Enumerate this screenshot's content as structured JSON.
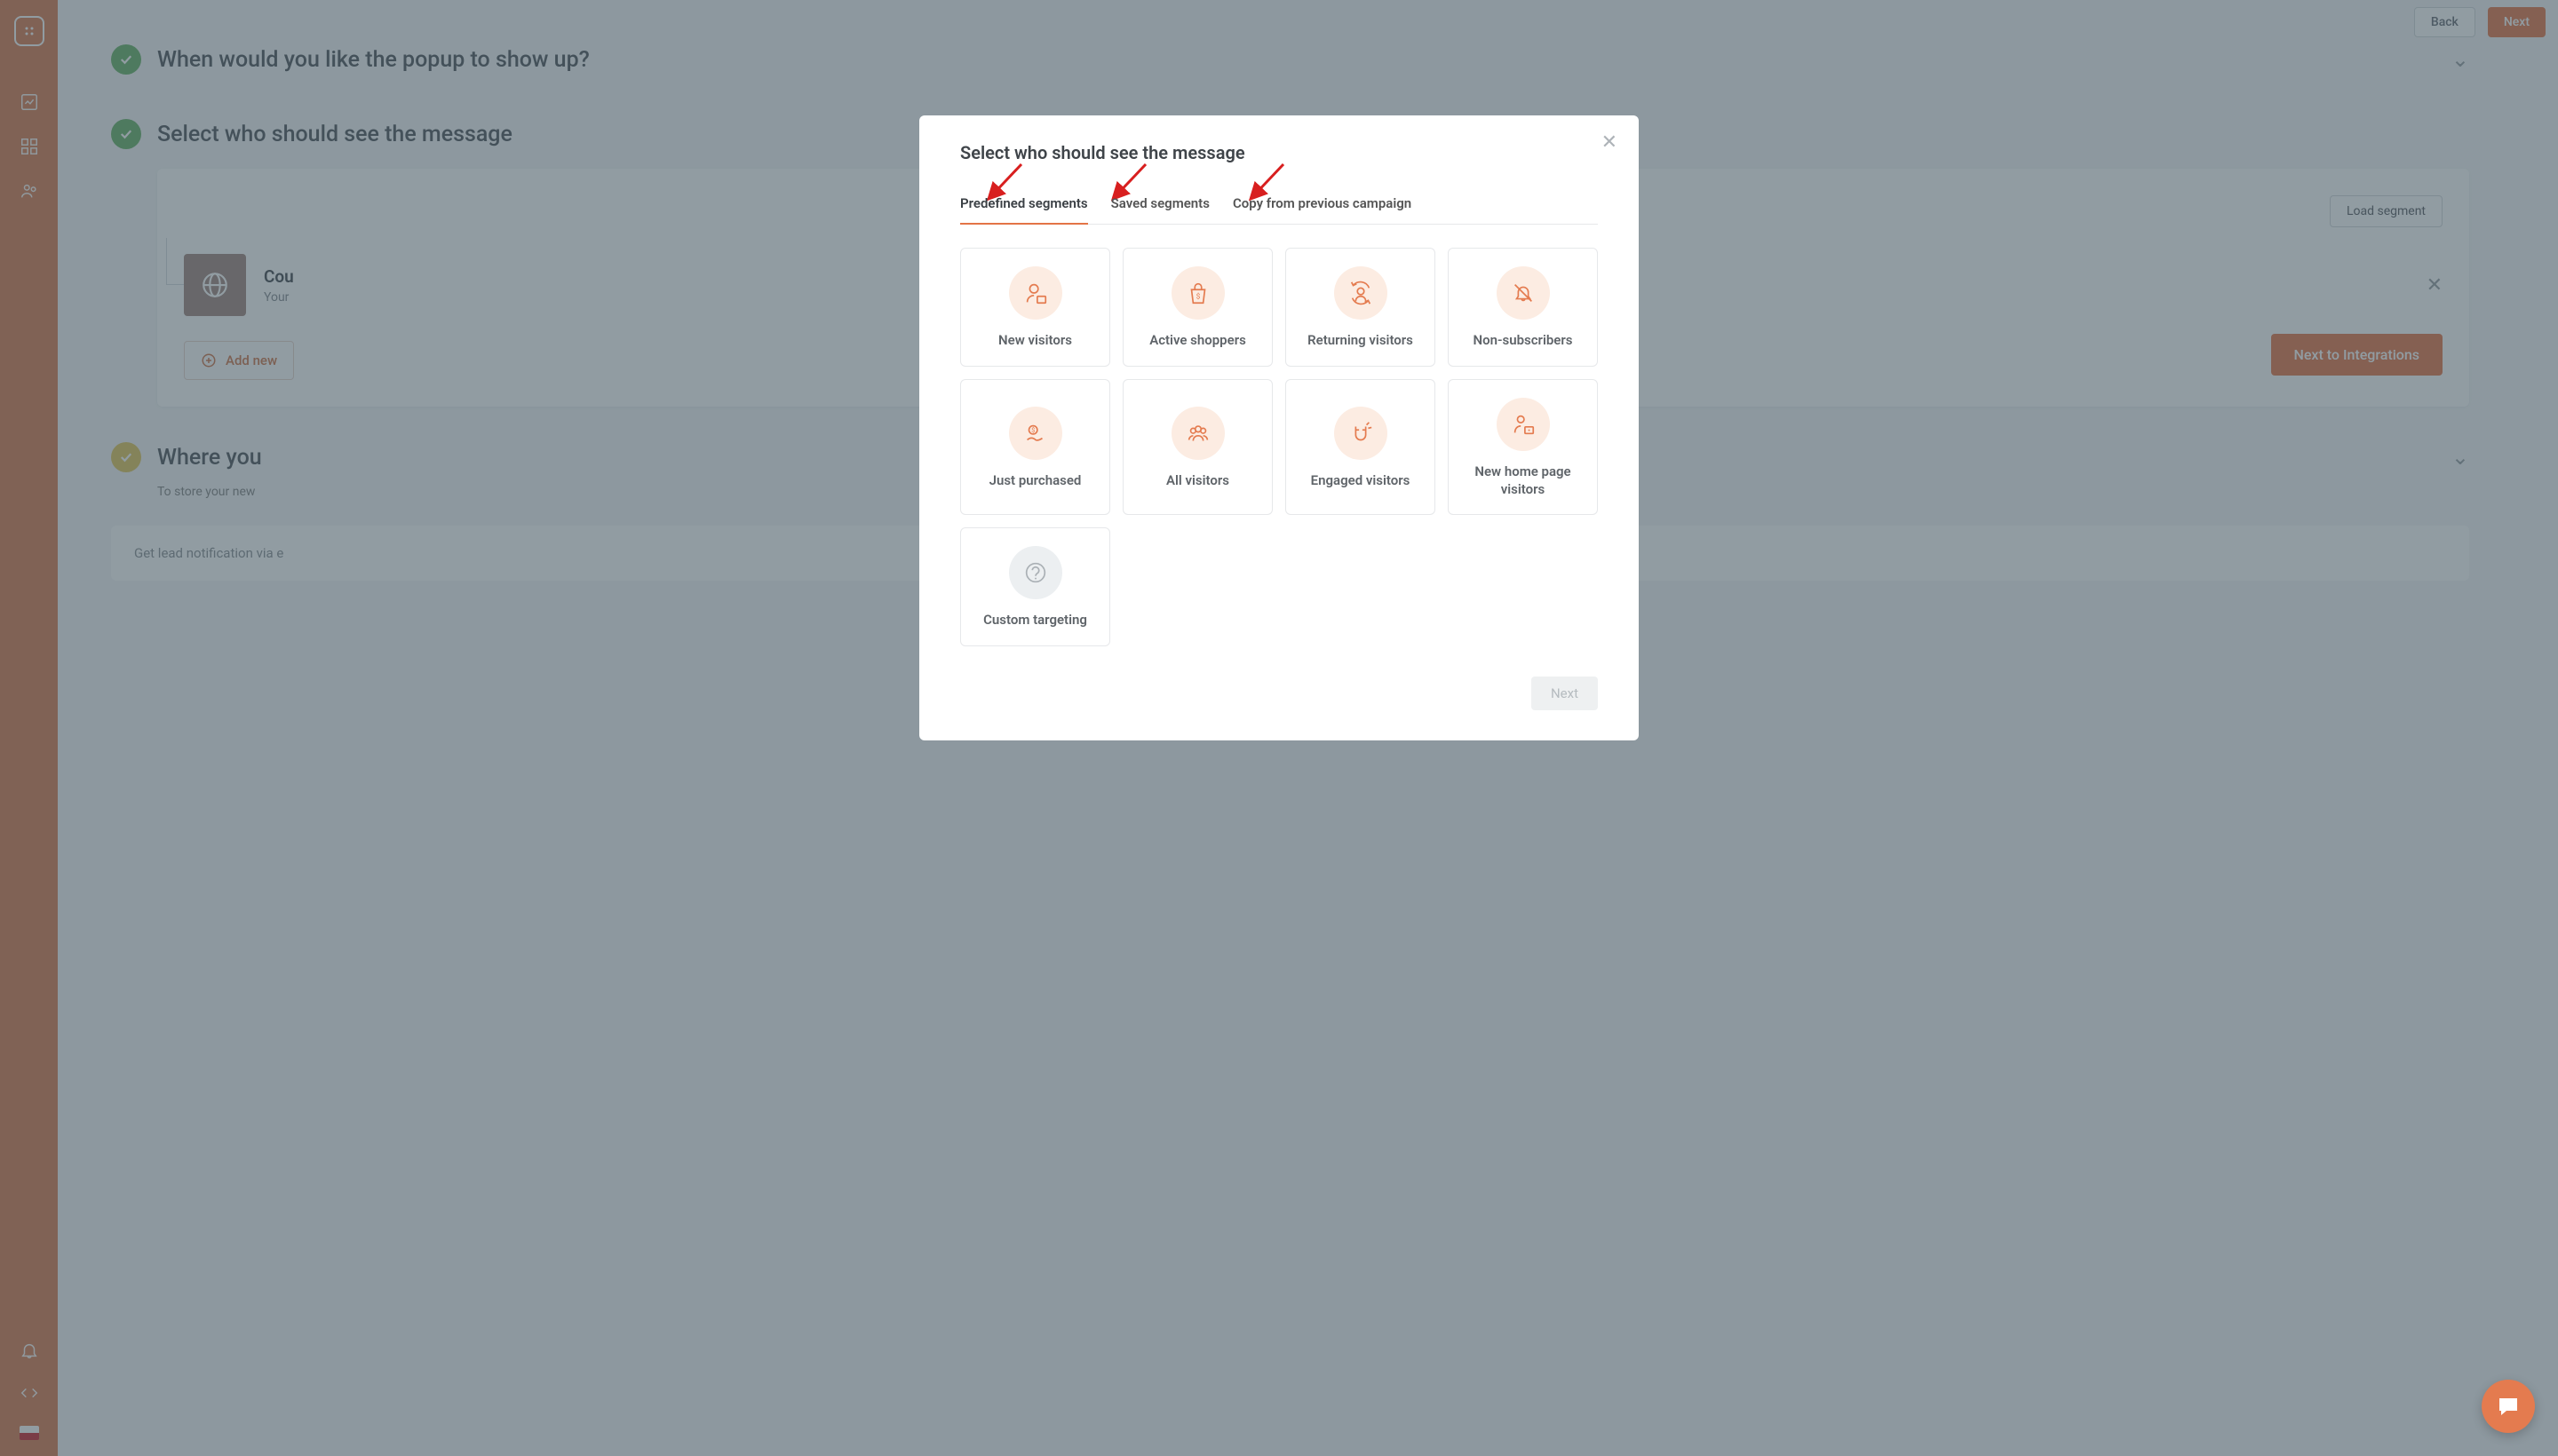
{
  "topbar": {
    "back": "Back",
    "next": "Next"
  },
  "sidebar": {
    "nav_icons": [
      "analytics-icon",
      "dashboard-icon",
      "audience-icon"
    ],
    "bottom_icons": [
      "bell-icon",
      "code-icon"
    ]
  },
  "sections": {
    "s1": {
      "title": "When would you like the popup to show up?"
    },
    "s2": {
      "title": "Select who should see the message",
      "load_segment": "Load segment",
      "rule": {
        "title": "Cou",
        "subtitle": "Your"
      },
      "add_rule": "Add new",
      "next_integrations": "Next to Integrations"
    },
    "s3": {
      "title": "Where you",
      "subtitle": "To store your new"
    },
    "lead": "Get lead notification via e"
  },
  "modal": {
    "title": "Select who should see the message",
    "tabs": [
      {
        "id": "predefined",
        "label": "Predefined segments",
        "active": true
      },
      {
        "id": "saved",
        "label": "Saved segments",
        "active": false
      },
      {
        "id": "previous",
        "label": "Copy from previous campaign",
        "active": false
      }
    ],
    "segments": [
      {
        "id": "new-visitors",
        "label": "New visitors",
        "icon": "user-new-icon",
        "color": "orange"
      },
      {
        "id": "active-shoppers",
        "label": "Active shoppers",
        "icon": "shopping-bag-icon",
        "color": "orange"
      },
      {
        "id": "returning-visitors",
        "label": "Returning visitors",
        "icon": "returning-icon",
        "color": "orange"
      },
      {
        "id": "non-subscribers",
        "label": "Non-subscribers",
        "icon": "bell-off-icon",
        "color": "orange"
      },
      {
        "id": "just-purchased",
        "label": "Just purchased",
        "icon": "purchase-icon",
        "color": "orange"
      },
      {
        "id": "all-visitors",
        "label": "All visitors",
        "icon": "group-icon",
        "color": "orange"
      },
      {
        "id": "engaged-visitors",
        "label": "Engaged visitors",
        "icon": "magnet-icon",
        "color": "orange"
      },
      {
        "id": "new-home-page",
        "label": "New home page visitors",
        "icon": "user-home-icon",
        "color": "orange"
      },
      {
        "id": "custom",
        "label": "Custom targeting",
        "icon": "question-icon",
        "color": "gray"
      }
    ],
    "footer_next": "Next"
  }
}
